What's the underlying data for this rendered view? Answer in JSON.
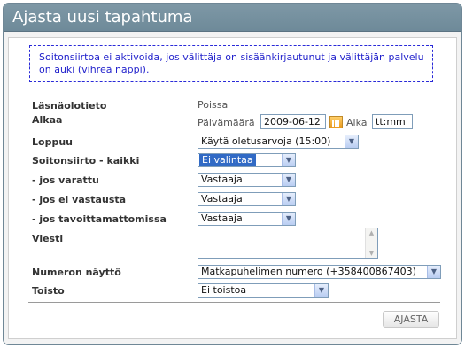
{
  "title": "Ajasta uusi tapahtuma",
  "notice": "Soitonsiirtoa ei aktivoida, jos välittäja on sisäänkirjautunut ja välittäjän palvelu on auki (vihreä nappi).",
  "presence": {
    "label": "Läsnäolotieto",
    "value": "Poissa"
  },
  "start": {
    "label": "Alkaa",
    "date_label": "Päivämäärä",
    "date_value": "2009-06-12",
    "time_label": "Aika",
    "time_value": "tt:mm"
  },
  "end": {
    "label": "Loppuu",
    "selected": "Käytä oletusarvoja (15:00)"
  },
  "forward_all": {
    "label": "Soitonsiirto - kaikki",
    "selected": "Ei valintaa"
  },
  "if_busy": {
    "label": "- jos varattu",
    "selected": "Vastaaja"
  },
  "if_no_answer": {
    "label": "- jos ei vastausta",
    "selected": "Vastaaja"
  },
  "if_unreachable": {
    "label": "- jos tavoittamattomissa",
    "selected": "Vastaaja"
  },
  "message": {
    "label": "Viesti",
    "value": ""
  },
  "number_display": {
    "label": "Numeron näyttö",
    "selected": "Matkapuhelimen numero (+358400867403)"
  },
  "repeat": {
    "label": "Toisto",
    "selected": "Ei toistoa"
  },
  "schedule_button": "AJASTA",
  "colors": {
    "titlebar": "#7e98a6",
    "notice_text": "#2222cc",
    "selected_highlight": "#316ac5"
  }
}
